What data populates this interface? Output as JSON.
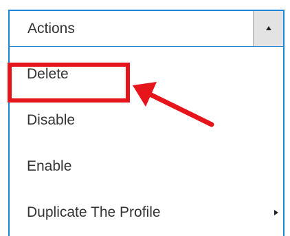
{
  "actions": {
    "label": "Actions",
    "menu": [
      {
        "label": "Delete"
      },
      {
        "label": "Disable"
      },
      {
        "label": "Enable"
      },
      {
        "label": "Duplicate The Profile",
        "has_submenu": true
      }
    ]
  },
  "annotation": {
    "color": "#e6141b",
    "highlighted_item": "Delete"
  },
  "colors": {
    "focus_border": "#1e84d6",
    "toggle_bg": "#e3e3e3",
    "text": "#333333"
  }
}
